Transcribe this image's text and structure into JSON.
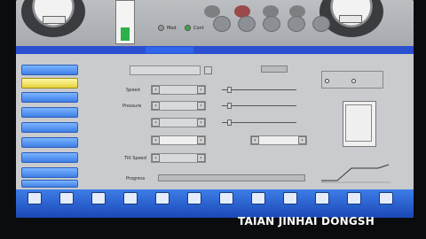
{
  "banner": "",
  "gauges": {
    "left_readout": "",
    "right_readout": ""
  },
  "tank": {
    "level": 0.35,
    "fill_color": "#2bb24a"
  },
  "mode_labels": [
    "Mod",
    "Cont"
  ],
  "top_buttons": [
    "",
    "",
    "",
    "",
    ""
  ],
  "tab_label": "",
  "sidebar_items": [
    "",
    "",
    "",
    "",
    "",
    "",
    "",
    "",
    ""
  ],
  "sidebar_active_index": 1,
  "form": {
    "top_label": "",
    "top_value": "",
    "top_right_label": "",
    "rows": [
      {
        "label": "Speed",
        "value": ""
      },
      {
        "label": "Pressure",
        "value": ""
      },
      {
        "label": "",
        "value": ""
      },
      {
        "label": "",
        "value": ""
      },
      {
        "label": "Tilt Speed",
        "value": ""
      }
    ],
    "extra_label": "",
    "extra_value": "",
    "status_text": "",
    "progress_label": "Progress",
    "progress": 0
  },
  "panel": {
    "title": "",
    "option_left": "",
    "option_right": "",
    "chart_label": ""
  },
  "fkeys": [
    "",
    "",
    "",
    "",
    "",
    "",
    "",
    "",
    "",
    "",
    "",
    ""
  ],
  "watermark": "TAIAN JINHAI DONGSH",
  "colors": {
    "accent": "#2a50d0",
    "active_item": "#e6d23a"
  }
}
